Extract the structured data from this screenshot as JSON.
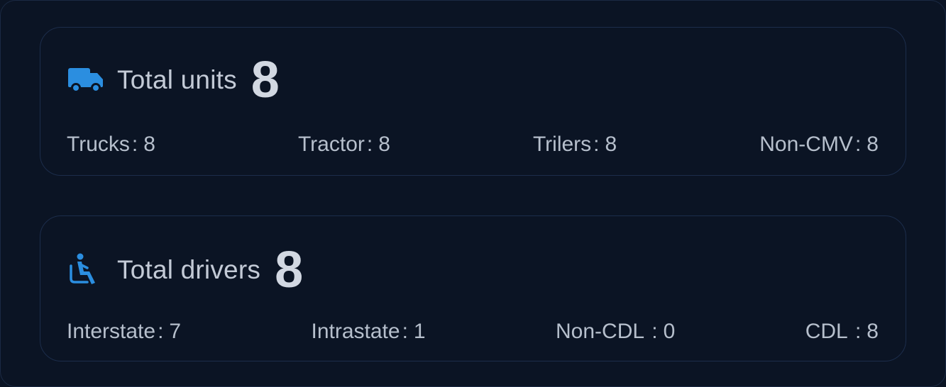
{
  "units": {
    "label": "Total units",
    "value": "8",
    "icon": "truck-icon",
    "stats": [
      {
        "label": "Trucks",
        "value": "8"
      },
      {
        "label": "Tractor",
        "value": "8"
      },
      {
        "label": "Trilers",
        "value": "8"
      },
      {
        "label": "Non-CMV",
        "value": "8"
      }
    ]
  },
  "drivers": {
    "label": "Total drivers",
    "value": "8",
    "icon": "seated-driver-icon",
    "stats": [
      {
        "label": "Interstate",
        "value": "7"
      },
      {
        "label": "Intrastate",
        "value": "1"
      },
      {
        "label": "Non-CDL ",
        "value": "0"
      },
      {
        "label": "CDL ",
        "value": "8"
      }
    ]
  },
  "colors": {
    "background": "#0b1424",
    "card_border": "#1c2d4b",
    "accent": "#2b8ee0",
    "text": "#c3cad6"
  }
}
